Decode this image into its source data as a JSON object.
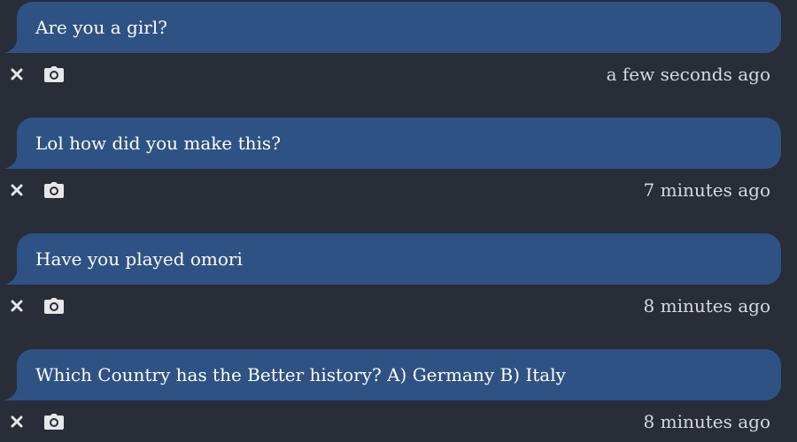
{
  "messages": [
    {
      "text": "Are you a girl?",
      "time": "a few seconds ago"
    },
    {
      "text": "Lol how did you make this?",
      "time": "7 minutes ago"
    },
    {
      "text": "Have you played omori",
      "time": "8 minutes ago"
    },
    {
      "text": "Which Country has the Better history? A) Germany B) Italy",
      "time": "8 minutes ago"
    }
  ],
  "icons": {
    "delete": "close-icon",
    "screenshot": "camera-icon"
  },
  "colors": {
    "background": "#282d38",
    "bubble": "#2e5283",
    "text": "#ffffff",
    "timestamp": "#d6d9de",
    "icon": "#e6e7ea"
  }
}
